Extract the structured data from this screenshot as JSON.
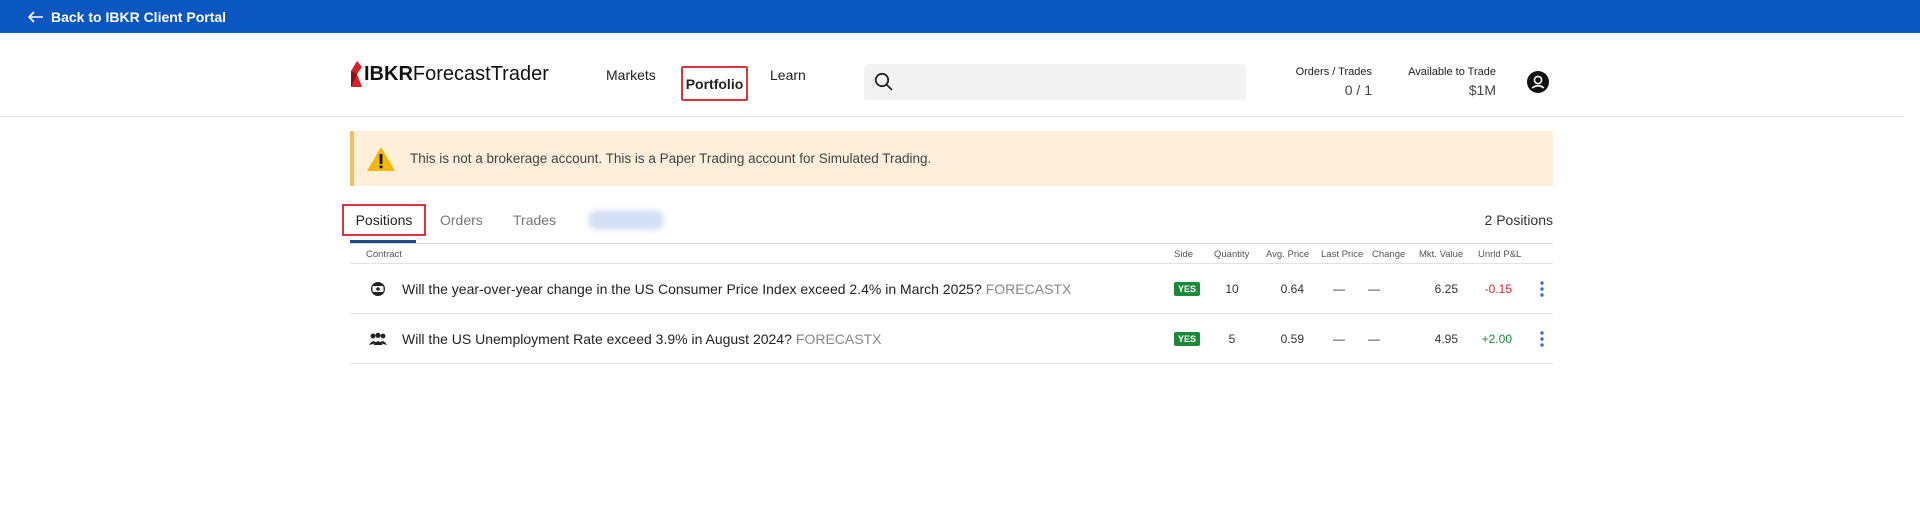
{
  "topbar": {
    "back_label": "Back to IBKR Client Portal"
  },
  "logo": {
    "bold": "IBKR",
    "rest": "ForecastTrader"
  },
  "nav": {
    "markets": "Markets",
    "portfolio": "Portfolio",
    "learn": "Learn"
  },
  "search": {
    "placeholder": "",
    "value": ""
  },
  "stats": {
    "orders_trades_label": "Orders / Trades",
    "orders_trades_value": "0 / 1",
    "available_label": "Available to Trade",
    "available_value": "$1M"
  },
  "banner": {
    "text": "This is not a brokerage account. This is a Paper Trading account for Simulated Trading."
  },
  "tabs": {
    "positions": "Positions",
    "orders": "Orders",
    "trades": "Trades",
    "count": "2 Positions"
  },
  "table": {
    "headers": {
      "contract": "Contract",
      "side": "Side",
      "quantity": "Quantity",
      "avg_price": "Avg. Price",
      "last_price": "Last Price",
      "change": "Change",
      "mkt_value": "Mkt. Value",
      "unrlzd_pnl": "Unrld P&L"
    },
    "rows": [
      {
        "icon": "cpi-icon",
        "contract": "Will the year-over-year change in the US Consumer Price Index exceed 2.4% in March 2025?",
        "tag": "FORECASTX",
        "side": "YES",
        "quantity": "10",
        "avg_price": "0.64",
        "last_price": "—",
        "change": "—",
        "mkt_value": "6.25",
        "pnl": "-0.15"
      },
      {
        "icon": "unemployment-icon",
        "contract": "Will the US Unemployment Rate exceed 3.9% in August 2024?",
        "tag": "FORECASTX",
        "side": "YES",
        "quantity": "5",
        "avg_price": "0.59",
        "last_price": "—",
        "change": "—",
        "mkt_value": "4.95",
        "pnl": "+2.00"
      }
    ]
  },
  "colors": {
    "topbar": "#0b57c2",
    "highlight": "#d9353b",
    "negative": "#d9253b",
    "positive": "#1a8a3a",
    "yes_badge": "#1a8a3a"
  }
}
